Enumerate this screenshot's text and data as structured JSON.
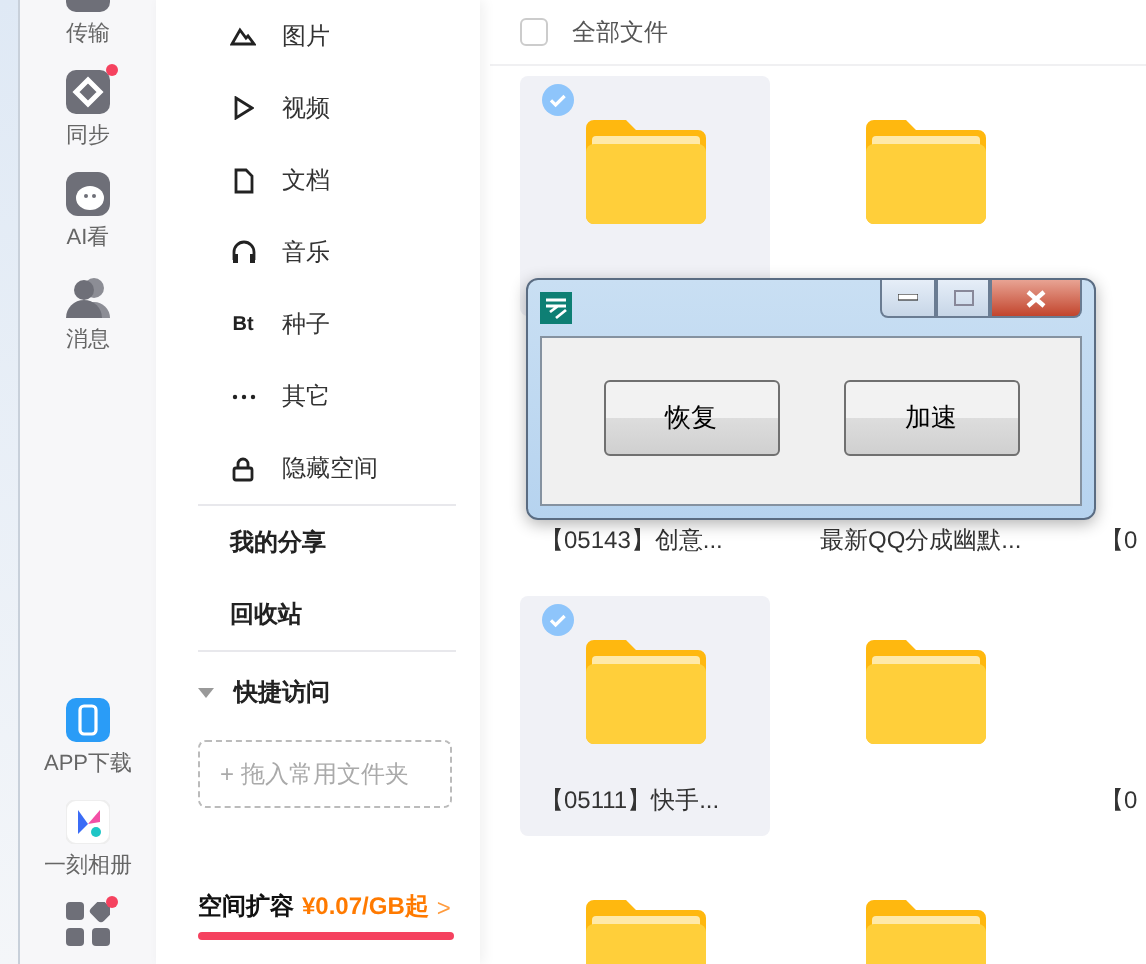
{
  "nav_rail": {
    "top": [
      {
        "label": "传输",
        "kind": "transfer",
        "badge": false
      },
      {
        "label": "同步",
        "kind": "sync",
        "badge": true
      },
      {
        "label": "AI看",
        "kind": "ai",
        "badge": false
      },
      {
        "label": "消息",
        "kind": "message",
        "badge": false
      }
    ],
    "bottom": [
      {
        "label": "APP下载",
        "kind": "app",
        "badge": false
      },
      {
        "label": "一刻相册",
        "kind": "album",
        "badge": false
      },
      {
        "kind": "grid",
        "badge": true
      }
    ]
  },
  "categories": [
    {
      "label": "图片",
      "kind": "image"
    },
    {
      "label": "视频",
      "kind": "video"
    },
    {
      "label": "文档",
      "kind": "doc"
    },
    {
      "label": "音乐",
      "kind": "music"
    },
    {
      "label": "种子",
      "kind": "torrent",
      "icon_text": "Bt"
    },
    {
      "label": "其它",
      "kind": "other"
    },
    {
      "label": "隐藏空间",
      "kind": "lock"
    }
  ],
  "links": [
    "我的分享",
    "回收站"
  ],
  "quick_access": {
    "title": "快捷访问",
    "expanded": true,
    "drop_hint": "+ 拖入常用文件夹"
  },
  "storage": {
    "label": "空间扩容",
    "price": "¥0.07/GB起",
    "arrow": ">"
  },
  "header": {
    "title": "全部文件",
    "checked": false
  },
  "files": [
    {
      "selected": true
    },
    {
      "selected": false
    },
    {
      "label": "【05143】创意...",
      "selected": false
    },
    {
      "label": "最新QQ分成幽默...",
      "selected": false
    },
    {
      "label": "【0",
      "selected": false
    },
    {
      "label": "【05111】快手...",
      "selected": true
    },
    {
      "selected": false
    },
    {
      "label": "【0",
      "selected": false
    },
    {
      "selected": false
    },
    {
      "selected": false
    }
  ],
  "dialog": {
    "buttons": [
      "恢复",
      "加速"
    ]
  }
}
